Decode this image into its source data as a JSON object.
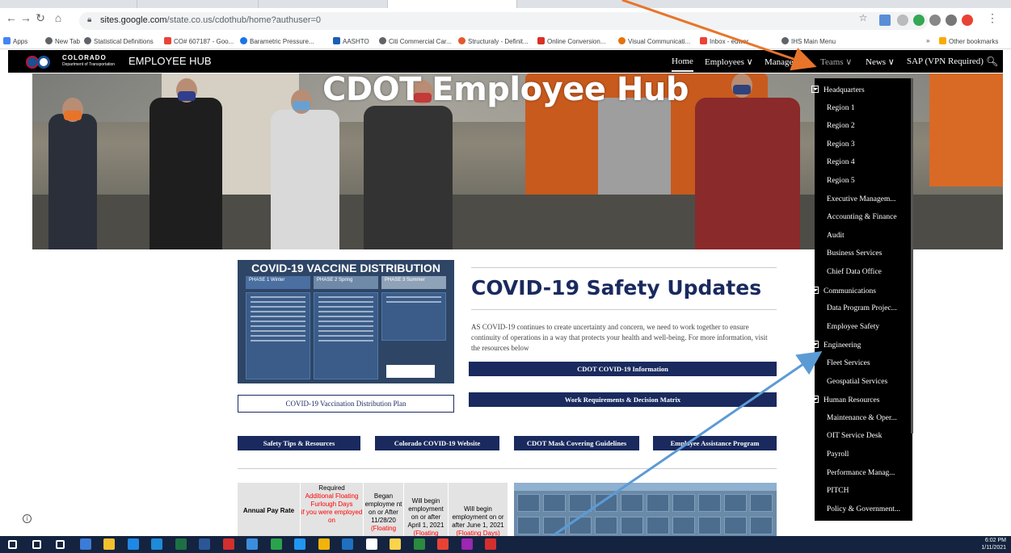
{
  "browser": {
    "url_host": "sites.google.com",
    "url_path": "/state.co.us/cdothub/home?authuser=0",
    "bookmarks": [
      {
        "label": "Apps",
        "color": "#4285f4"
      },
      {
        "label": "New Tab",
        "color": "#5f6368"
      },
      {
        "label": "Statistical Definitions",
        "color": "#5f6368"
      },
      {
        "label": "CO# 607187 - Goo...",
        "color": "#ea4335"
      },
      {
        "label": "Barametric Pressure...",
        "color": "#1a73e8"
      },
      {
        "label": "AASHTO",
        "color": "#1a5fb4"
      },
      {
        "label": "Citi Commercial Car...",
        "color": "#5f6368"
      },
      {
        "label": "Structuraly - Definit...",
        "color": "#e4572e"
      },
      {
        "label": "Online Conversion...",
        "color": "#d93025"
      },
      {
        "label": "Visual Communicati...",
        "color": "#e8710a"
      },
      {
        "label": "Inbox - edwar",
        "color": "#ea4335"
      },
      {
        "label": "IHS Main Menu",
        "color": "#5f6368"
      },
      {
        "label": "»",
        "color": "#ffffff"
      },
      {
        "label": "Other bookmarks",
        "color": "#f9ab00"
      }
    ]
  },
  "site": {
    "brand_line1": "COLORADO",
    "brand_line2": "Department of Transportation",
    "hub_name": "EMPLOYEE HUB",
    "nav": {
      "home": "Home",
      "employees": "Employees ∨",
      "managers": "Managers ∨",
      "teams": "Teams ∨",
      "news": "News ∨",
      "sap": "SAP (VPN Required)"
    },
    "hero_title": "CDOT Employee Hub"
  },
  "main": {
    "poster_title": "COVID-19 VACCINE DISTRIBUTION",
    "phases": [
      "PHASE 1 Winter",
      "PHASE 2 Spring",
      "PHASE 3 Summer"
    ],
    "plan_button": "COVID-19 Vaccination Distribution Plan",
    "section_title": "COVID-19 Safety Updates",
    "body_text": "AS COVID-19 continues to create uncertainty and concern, we need to work together to ensure continuity of operations in a way that protects your health and well-being. For more information, visit the resources below",
    "btn_info": "CDOT COVID-19 Information",
    "btn_work": "Work Requirements & Decision Matrix",
    "btn_safety": "Safety Tips & Resources",
    "btn_colorado": "Colorado COVID-19 Website",
    "btn_mask": "CDOT Mask Covering Guidelines",
    "btn_eap": "Employee Assistance Program"
  },
  "pay_table": {
    "col1": "Annual Pay Rate",
    "col2_black": "Required",
    "col2_red": "Additional Floating Furlough Days",
    "col2_tail_red": "if you were employed on",
    "col3": "Began employme nt on or After 11/28/20",
    "col3_red": "(Floating",
    "col4": "Will begin employment on or after April 1, 2021",
    "col4_red": "(Floating",
    "col5": "Will begin employment on or after June 1, 2021",
    "col5_red": "(Floating Days)"
  },
  "teams_menu": {
    "items": [
      {
        "label": "Headquarters",
        "expandable": true
      },
      {
        "label": "Region 1",
        "expandable": false
      },
      {
        "label": "Region 2",
        "expandable": false
      },
      {
        "label": "Region 3",
        "expandable": false
      },
      {
        "label": "Region 4",
        "expandable": false
      },
      {
        "label": "Region 5",
        "expandable": false
      },
      {
        "label": "Executive Managem...",
        "expandable": false
      },
      {
        "label": "Accounting & Finance",
        "expandable": false
      },
      {
        "label": "Audit",
        "expandable": false
      },
      {
        "label": "Business Services",
        "expandable": false
      },
      {
        "label": "Chief Data Office",
        "expandable": false
      },
      {
        "label": "Communications",
        "expandable": true
      },
      {
        "label": "Data Program Projec...",
        "expandable": false
      },
      {
        "label": "Employee Safety",
        "expandable": false
      },
      {
        "label": "Engineering",
        "expandable": true
      },
      {
        "label": "Fleet Services",
        "expandable": false
      },
      {
        "label": "Geospatial Services",
        "expandable": false
      },
      {
        "label": "Human Resources",
        "expandable": true
      },
      {
        "label": "Maintenance & Oper...",
        "expandable": false
      },
      {
        "label": "OIT Service Desk",
        "expandable": false
      },
      {
        "label": "Payroll",
        "expandable": false
      },
      {
        "label": "Performance Manag...",
        "expandable": false
      },
      {
        "label": "PITCH",
        "expandable": false
      },
      {
        "label": "Policy & Government...",
        "expandable": false
      }
    ]
  },
  "taskbar": {
    "time": "6:02 PM",
    "date": "1/11/2021",
    "icons": [
      "start-icon",
      "search-icon",
      "task-view-icon",
      "calculator-icon",
      "file-explorer-icon",
      "edge-icon",
      "app-icon",
      "excel-icon",
      "word-icon",
      "acrobat-icon",
      "dropbox-icon",
      "chrome-icon",
      "chrome-alt-icon",
      "folder-icon",
      "outlook-icon",
      "hyperion-icon",
      "sticky-notes-icon",
      "project-icon",
      "chrome-profile-icon",
      "chrome-profile-2-icon",
      "acrobat-dc-icon"
    ]
  },
  "colors": {
    "navy": "#1a2a5e",
    "arrow_orange": "#e8742a",
    "arrow_blue": "#5b9bd5"
  }
}
